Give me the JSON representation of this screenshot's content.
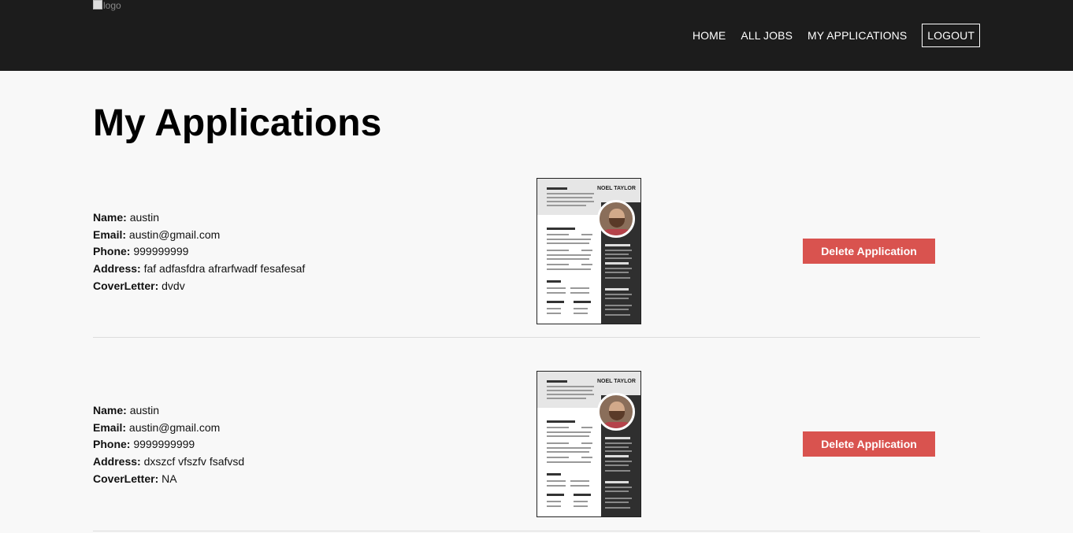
{
  "header": {
    "logo_alt": "logo",
    "nav": [
      {
        "label": "HOME"
      },
      {
        "label": "ALL JOBS"
      },
      {
        "label": "MY APPLICATIONS"
      },
      {
        "label": "LOGOUT"
      }
    ]
  },
  "page": {
    "title": "My Applications"
  },
  "labels": {
    "name": "Name:",
    "email": "Email:",
    "phone": "Phone:",
    "address": "Address:",
    "cover_letter": "CoverLetter:"
  },
  "applications": [
    {
      "name": "austin",
      "email": "austin@gmail.com",
      "phone": "999999999",
      "address": "faf adfasfdra afrarfwadf fesafesaf",
      "cover_letter": "dvdv",
      "resume_name": "NOEL TAYLOR",
      "delete_label": "Delete Application"
    },
    {
      "name": "austin",
      "email": "austin@gmail.com",
      "phone": "9999999999",
      "address": "dxszcf vfszfv fsafvsd",
      "cover_letter": "NA",
      "resume_name": "NOEL TAYLOR",
      "delete_label": "Delete Application"
    }
  ],
  "colors": {
    "navbar": "#1c1c1c",
    "delete_button": "#d9534f",
    "background": "#f8f8f8"
  }
}
